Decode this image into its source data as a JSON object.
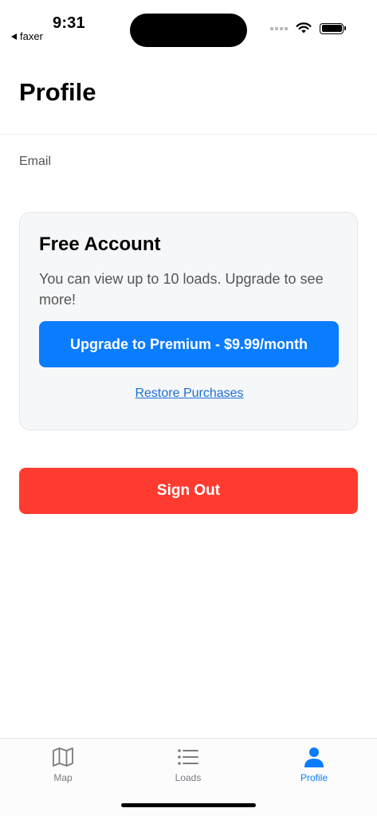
{
  "status_bar": {
    "time": "9:31",
    "back_app": "faxer"
  },
  "header": {
    "title": "Profile"
  },
  "profile": {
    "email_label": "Email"
  },
  "account_card": {
    "title": "Free Account",
    "description": "You can view up to 10 loads. Upgrade to see more!",
    "upgrade_label": "Upgrade to Premium - $9.99/month",
    "restore_label": "Restore Purchases"
  },
  "signout_label": "Sign Out",
  "tabs": [
    {
      "label": "Map",
      "icon": "map-icon",
      "active": false
    },
    {
      "label": "Loads",
      "icon": "list-icon",
      "active": false
    },
    {
      "label": "Profile",
      "icon": "person-icon",
      "active": true
    }
  ],
  "colors": {
    "accent": "#0a7cff",
    "danger": "#ff3b30",
    "card_bg": "#f6f7f9",
    "inactive_tab": "#7a7a80"
  }
}
